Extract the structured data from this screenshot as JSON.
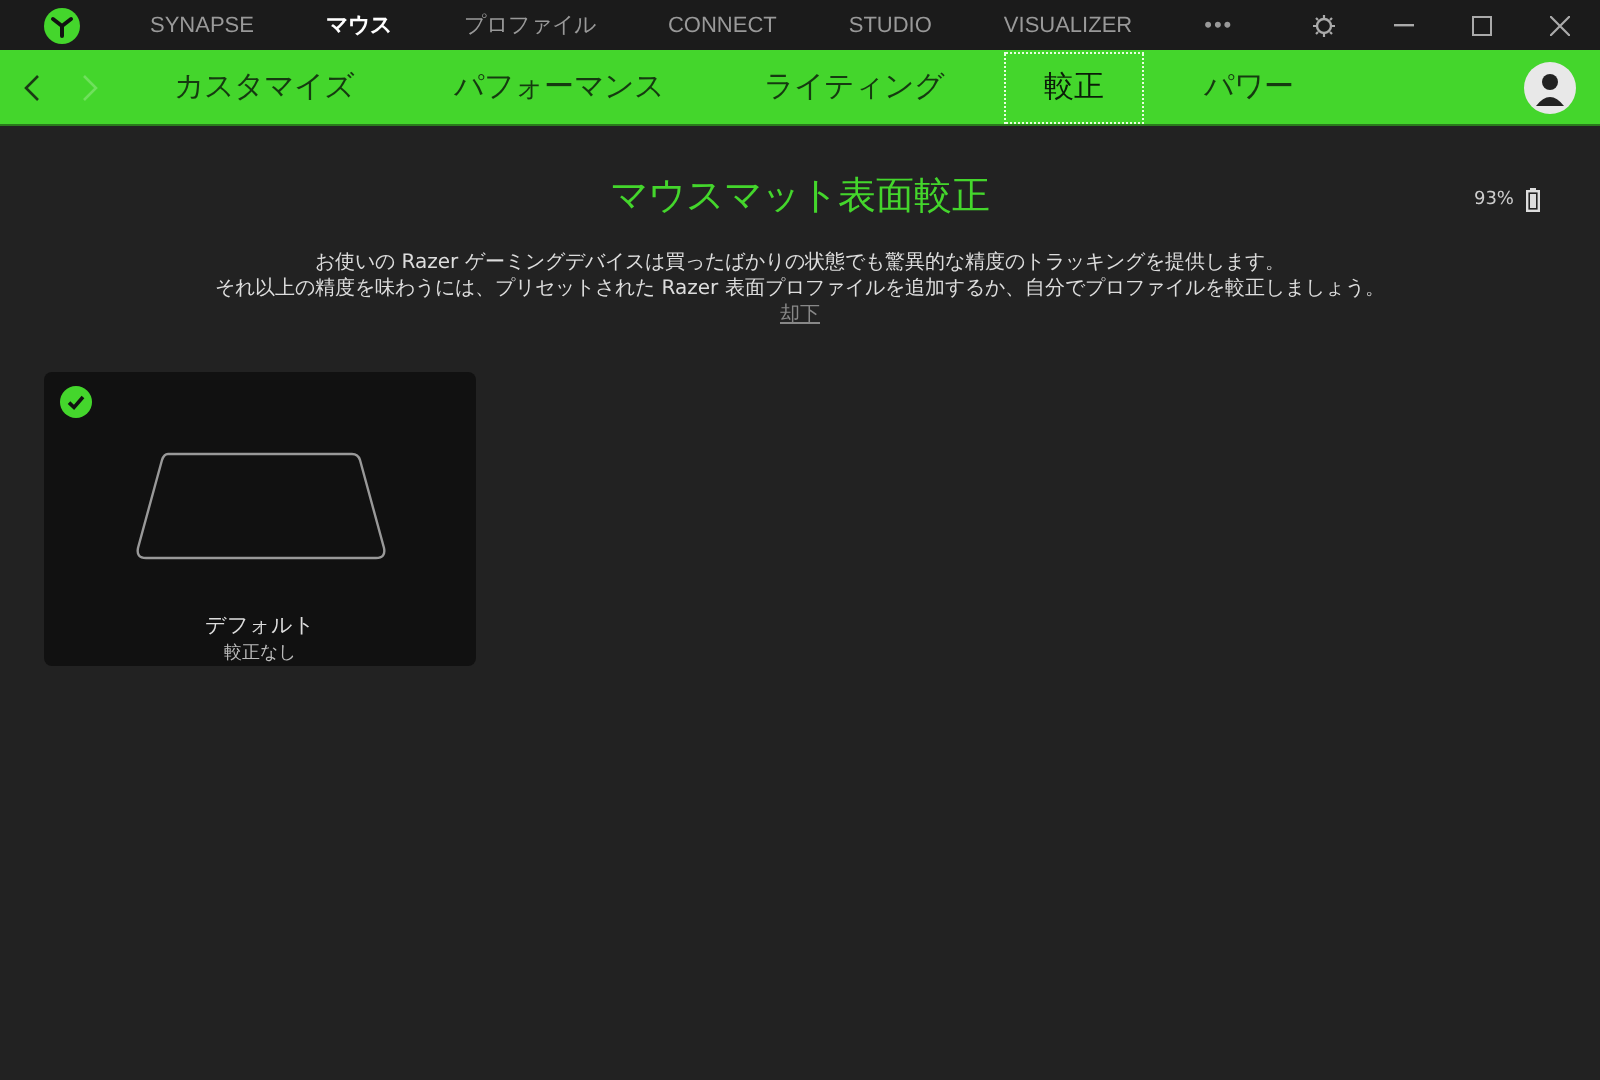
{
  "top_nav": [
    {
      "label": "SYNAPSE",
      "selected": false
    },
    {
      "label": "マウス",
      "selected": true
    },
    {
      "label": "プロファイル",
      "selected": false
    },
    {
      "label": "CONNECT",
      "selected": false
    },
    {
      "label": "STUDIO",
      "selected": false
    },
    {
      "label": "VISUALIZER",
      "selected": false
    }
  ],
  "more": "•••",
  "back": {
    "disabled": false
  },
  "forward": {
    "disabled": true
  },
  "tabs": [
    {
      "label": "カスタマイズ",
      "selected": false
    },
    {
      "label": "パフォーマンス",
      "selected": false
    },
    {
      "label": "ライティング",
      "selected": false
    },
    {
      "label": "較正",
      "selected": true
    },
    {
      "label": "パワー",
      "selected": false
    }
  ],
  "battery": {
    "reading": "93%"
  },
  "title": "マウスマット表面較正",
  "description": [
    "お使いの Razer ゲーミングデバイスは買ったばかりの状態でも驚異的な精度のトラッキングを提供します。",
    "それ以上の精度を味わうには、プリセットされた Razer 表面プロファイルを追加するか、自分でプロファイルを較正しましょう。"
  ],
  "dismiss": "却下",
  "surfaces": [
    {
      "name": "デフォルト",
      "status": "較正なし",
      "selected": true
    }
  ]
}
